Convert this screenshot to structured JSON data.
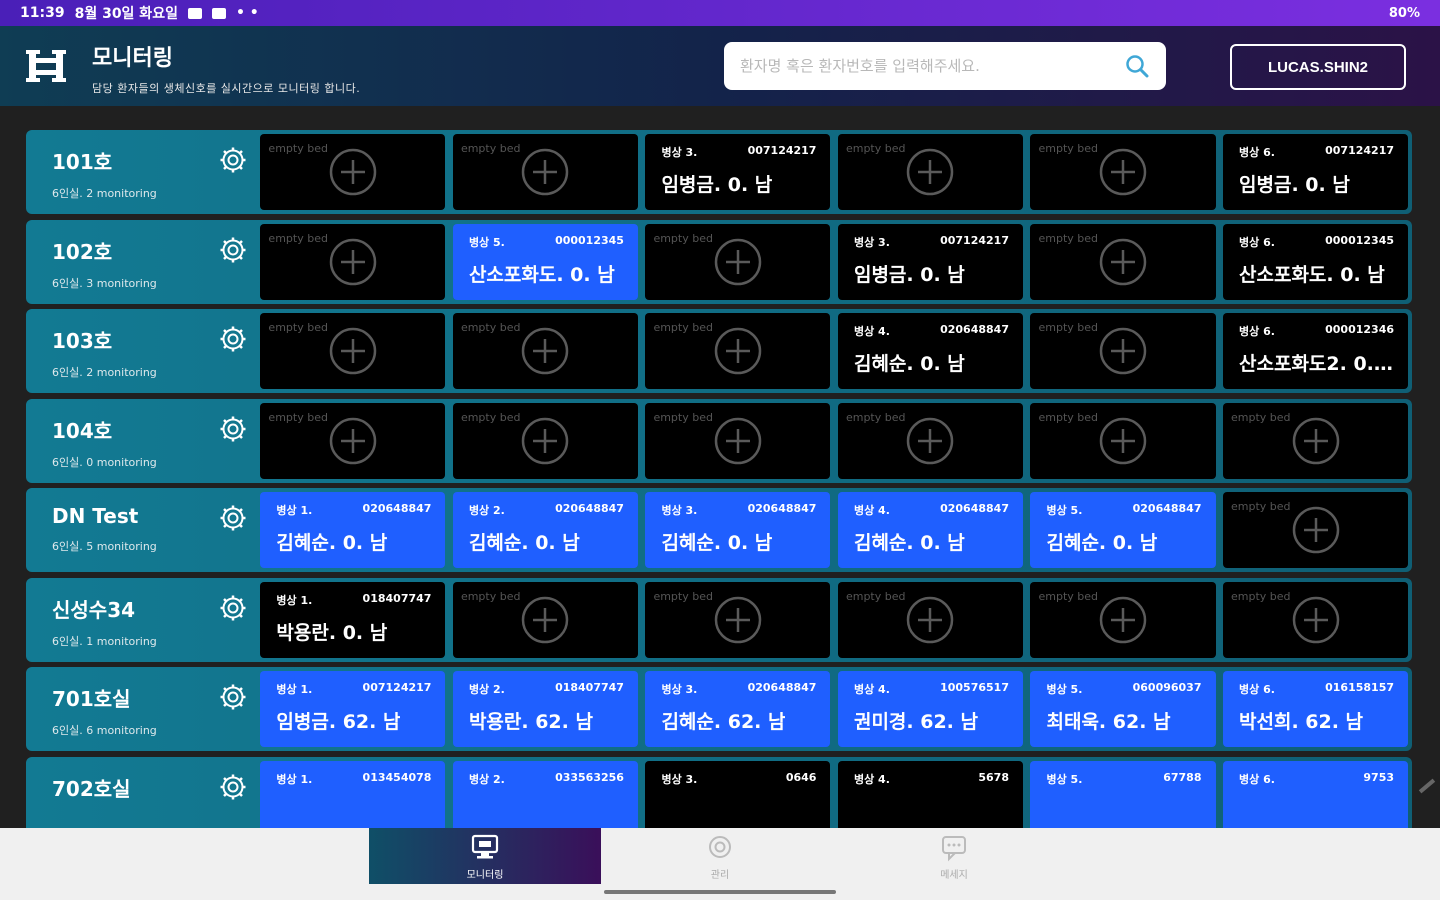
{
  "status_bar": {
    "time": "11:39",
    "date": "8월 30일 화요일",
    "right": "80%"
  },
  "header": {
    "title": "모니터링",
    "subtitle": "담당 환자들의 생체신호를 실시간으로 모니터링 합니다.",
    "search_placeholder": "환자명 혹은 환자번호를 입력해주세요.",
    "user_button": "LUCAS.SHIN2"
  },
  "empty_bed_label": "empty bed",
  "rooms": [
    {
      "name": "101호",
      "sub": "6인실. 2 monitoring",
      "beds": [
        {
          "state": "empty"
        },
        {
          "state": "empty"
        },
        {
          "state": "black",
          "no": "병상 3.",
          "pid": "007124217",
          "name": "임병금. 0. 남"
        },
        {
          "state": "empty"
        },
        {
          "state": "empty"
        },
        {
          "state": "black",
          "no": "병상 6.",
          "pid": "007124217",
          "name": "임병금. 0. 남"
        }
      ]
    },
    {
      "name": "102호",
      "sub": "6인실. 3 monitoring",
      "beds": [
        {
          "state": "empty"
        },
        {
          "state": "blue",
          "no": "병상 5.",
          "pid": "000012345",
          "name": "산소포화도. 0. 남"
        },
        {
          "state": "empty"
        },
        {
          "state": "black",
          "no": "병상 3.",
          "pid": "007124217",
          "name": "임병금. 0. 남"
        },
        {
          "state": "empty"
        },
        {
          "state": "black",
          "no": "병상 6.",
          "pid": "000012345",
          "name": "산소포화도. 0. 남"
        }
      ]
    },
    {
      "name": "103호",
      "sub": "6인실. 2 monitoring",
      "beds": [
        {
          "state": "empty"
        },
        {
          "state": "empty"
        },
        {
          "state": "empty"
        },
        {
          "state": "black",
          "no": "병상 4.",
          "pid": "020648847",
          "name": "김혜순. 0. 남"
        },
        {
          "state": "empty"
        },
        {
          "state": "black",
          "no": "병상 6.",
          "pid": "000012346",
          "name": "산소포화도2. 0. ..."
        }
      ]
    },
    {
      "name": "104호",
      "sub": "6인실. 0 monitoring",
      "beds": [
        {
          "state": "empty"
        },
        {
          "state": "empty"
        },
        {
          "state": "empty"
        },
        {
          "state": "empty"
        },
        {
          "state": "empty"
        },
        {
          "state": "empty"
        }
      ]
    },
    {
      "name": "DN Test",
      "sub": "6인실. 5 monitoring",
      "beds": [
        {
          "state": "blue",
          "no": "병상 1.",
          "pid": "020648847",
          "name": "김혜순. 0. 남"
        },
        {
          "state": "blue",
          "no": "병상 2.",
          "pid": "020648847",
          "name": "김혜순. 0. 남"
        },
        {
          "state": "blue",
          "no": "병상 3.",
          "pid": "020648847",
          "name": "김혜순. 0. 남"
        },
        {
          "state": "blue",
          "no": "병상 4.",
          "pid": "020648847",
          "name": "김혜순. 0. 남"
        },
        {
          "state": "blue",
          "no": "병상 5.",
          "pid": "020648847",
          "name": "김혜순. 0. 남"
        },
        {
          "state": "empty"
        }
      ]
    },
    {
      "name": "신성수34",
      "sub": "6인실. 1 monitoring",
      "beds": [
        {
          "state": "black",
          "no": "병상 1.",
          "pid": "018407747",
          "name": "박용란. 0. 남"
        },
        {
          "state": "empty"
        },
        {
          "state": "empty"
        },
        {
          "state": "empty"
        },
        {
          "state": "empty"
        },
        {
          "state": "empty"
        }
      ]
    },
    {
      "name": "701호실",
      "sub": "6인실. 6 monitoring",
      "beds": [
        {
          "state": "blue",
          "no": "병상 1.",
          "pid": "007124217",
          "name": "임병금. 62. 남"
        },
        {
          "state": "blue",
          "no": "병상 2.",
          "pid": "018407747",
          "name": "박용란. 62. 남"
        },
        {
          "state": "blue",
          "no": "병상 3.",
          "pid": "020648847",
          "name": "김혜순. 62. 남"
        },
        {
          "state": "blue",
          "no": "병상 4.",
          "pid": "100576517",
          "name": "권미경. 62. 남"
        },
        {
          "state": "blue",
          "no": "병상 5.",
          "pid": "060096037",
          "name": "최태욱. 62. 남"
        },
        {
          "state": "blue",
          "no": "병상 6.",
          "pid": "016158157",
          "name": "박선희. 62. 남"
        }
      ]
    },
    {
      "name": "702호실",
      "sub": "",
      "beds": [
        {
          "state": "blue",
          "no": "병상 1.",
          "pid": "013454078",
          "name": ""
        },
        {
          "state": "blue",
          "no": "병상 2.",
          "pid": "033563256",
          "name": ""
        },
        {
          "state": "black",
          "no": "병상 3.",
          "pid": "0646",
          "name": ""
        },
        {
          "state": "black",
          "no": "병상 4.",
          "pid": "5678",
          "name": ""
        },
        {
          "state": "blue",
          "no": "병상 5.",
          "pid": "67788",
          "name": ""
        },
        {
          "state": "blue",
          "no": "병상 6.",
          "pid": "9753",
          "name": ""
        }
      ]
    }
  ],
  "bottom_nav": [
    {
      "label": "모니터링",
      "icon": "monitor-icon",
      "active": true
    },
    {
      "label": "관리",
      "icon": "gear-icon",
      "active": false
    },
    {
      "label": "메세지",
      "icon": "message-icon",
      "active": false
    }
  ],
  "colors": {
    "room_row": "#127a93",
    "bed_active": "#1f5fff",
    "bed_inactive": "#000000",
    "status_bar": "#5a24d0"
  }
}
